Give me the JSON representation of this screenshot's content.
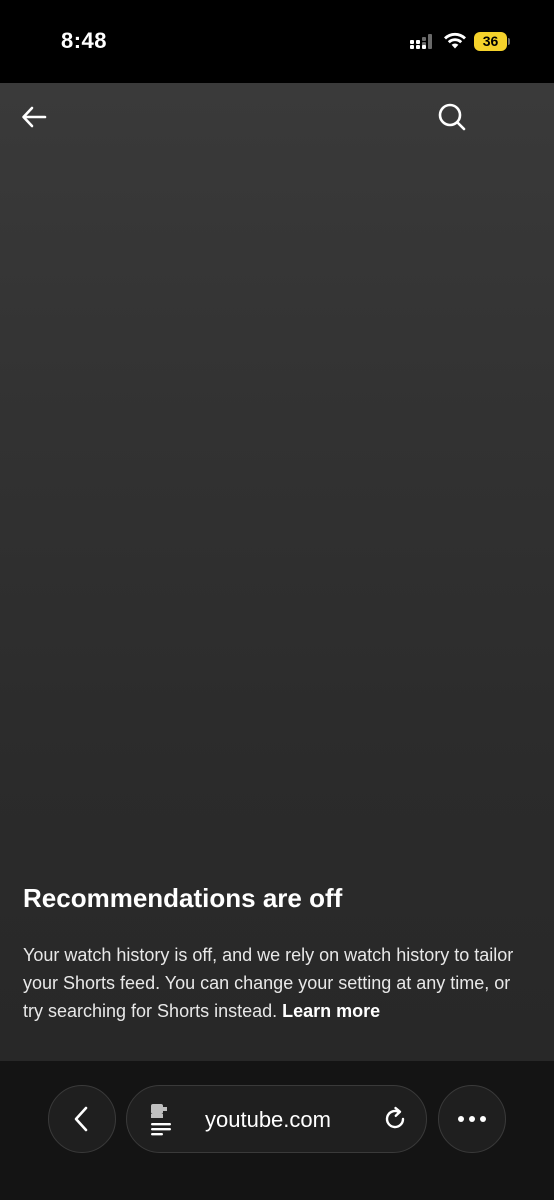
{
  "status_bar": {
    "time": "8:48",
    "battery_level": "36",
    "battery_color": "#f5d22b",
    "icons": [
      "cellular-signal-icon",
      "wifi-icon",
      "battery-icon"
    ]
  },
  "top_bar": {
    "icons": [
      "arrow-left-icon",
      "search-icon"
    ]
  },
  "recommendations": {
    "title": "Recommendations are off",
    "body": "Your watch history is off, and we rely on watch history to tailor your Shorts feed. You can change your setting at any time, or try searching for Shorts instead.",
    "link": "Learn more"
  },
  "browser_bar": {
    "url": "youtube.com",
    "icons": [
      "chevron-left-icon",
      "page-info-icon",
      "reload-icon",
      "more-icon"
    ]
  }
}
